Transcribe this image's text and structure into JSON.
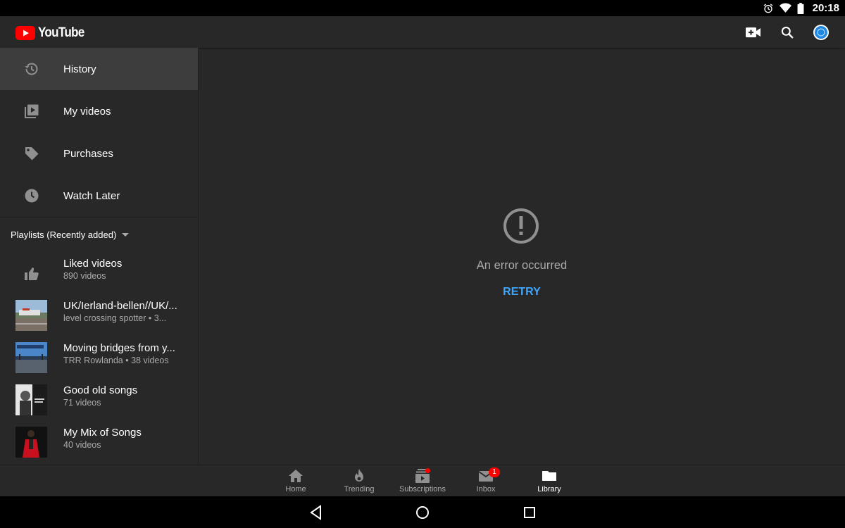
{
  "status_bar": {
    "time": "20:18",
    "icons": [
      "alarm-icon",
      "wifi-icon",
      "battery-icon"
    ]
  },
  "app_bar": {
    "logo_text": "YouTube",
    "actions": [
      "video-camera-add-icon",
      "search-icon",
      "avatar"
    ]
  },
  "sidebar": {
    "nav_items": [
      {
        "label": "History",
        "icon": "history-icon",
        "active": true
      },
      {
        "label": "My videos",
        "icon": "my-videos-icon",
        "active": false
      },
      {
        "label": "Purchases",
        "icon": "tag-icon",
        "active": false
      },
      {
        "label": "Watch Later",
        "icon": "clock-icon",
        "active": false
      }
    ],
    "playlists_header": "Playlists (Recently added)",
    "playlists": [
      {
        "title": "Liked videos",
        "subtitle": "890 videos",
        "icon": "thumbs-up-icon"
      },
      {
        "title": "UK/Ierland-bellen//UK/...",
        "subtitle": "level crossing spotter • 3..."
      },
      {
        "title": "Moving bridges from y...",
        "subtitle": "TRR Rowlanda • 38 videos"
      },
      {
        "title": "Good old songs",
        "subtitle": "71 videos"
      },
      {
        "title": "My Mix of Songs",
        "subtitle": "40 videos"
      }
    ]
  },
  "main": {
    "error_text": "An error occurred",
    "retry_label": "RETRY"
  },
  "bottom_nav": {
    "tabs": [
      {
        "label": "Home",
        "icon": "home-icon",
        "active": false
      },
      {
        "label": "Trending",
        "icon": "flame-icon",
        "active": false
      },
      {
        "label": "Subscriptions",
        "icon": "subscriptions-icon",
        "active": false,
        "dot": true
      },
      {
        "label": "Inbox",
        "icon": "mail-icon",
        "active": false,
        "badge": "1"
      },
      {
        "label": "Library",
        "icon": "folder-icon",
        "active": true
      }
    ]
  },
  "system_nav": [
    "back-icon",
    "home-circle-icon",
    "recents-icon"
  ],
  "colors": {
    "background": "#282828",
    "accent_blue": "#3ea6ff",
    "brand_red": "#ff0000",
    "active_row": "#3d3d3d"
  }
}
